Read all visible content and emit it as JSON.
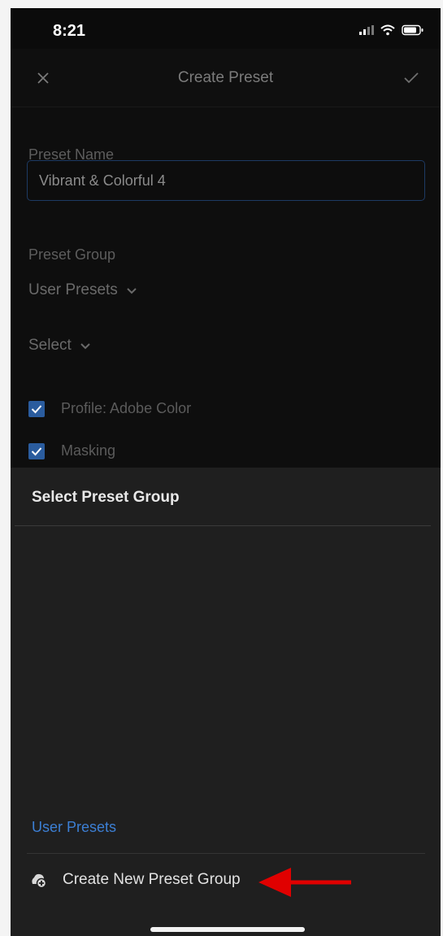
{
  "status_bar": {
    "time": "8:21",
    "icons": [
      "signal-icon",
      "wifi-icon",
      "battery-icon"
    ]
  },
  "nav": {
    "title": "Create Preset",
    "close_icon": "close-icon",
    "confirm_icon": "checkmark-icon"
  },
  "form": {
    "name_label": "Preset Name",
    "name_value": "Vibrant & Colorful 4",
    "group_label": "Preset Group",
    "group_value": "User Presets",
    "select_label": "Select",
    "checks": [
      {
        "label": "Profile: Adobe Color",
        "checked": true
      },
      {
        "label": "Masking",
        "checked": true
      }
    ]
  },
  "sheet": {
    "title": "Select Preset Group",
    "option": "User Presets",
    "create_label": "Create New Preset Group",
    "create_icon": "add-group-icon"
  },
  "colors": {
    "accent": "#3c7fd4",
    "checkbox": "#2a5c9e",
    "annotation_arrow": "#e00000"
  }
}
